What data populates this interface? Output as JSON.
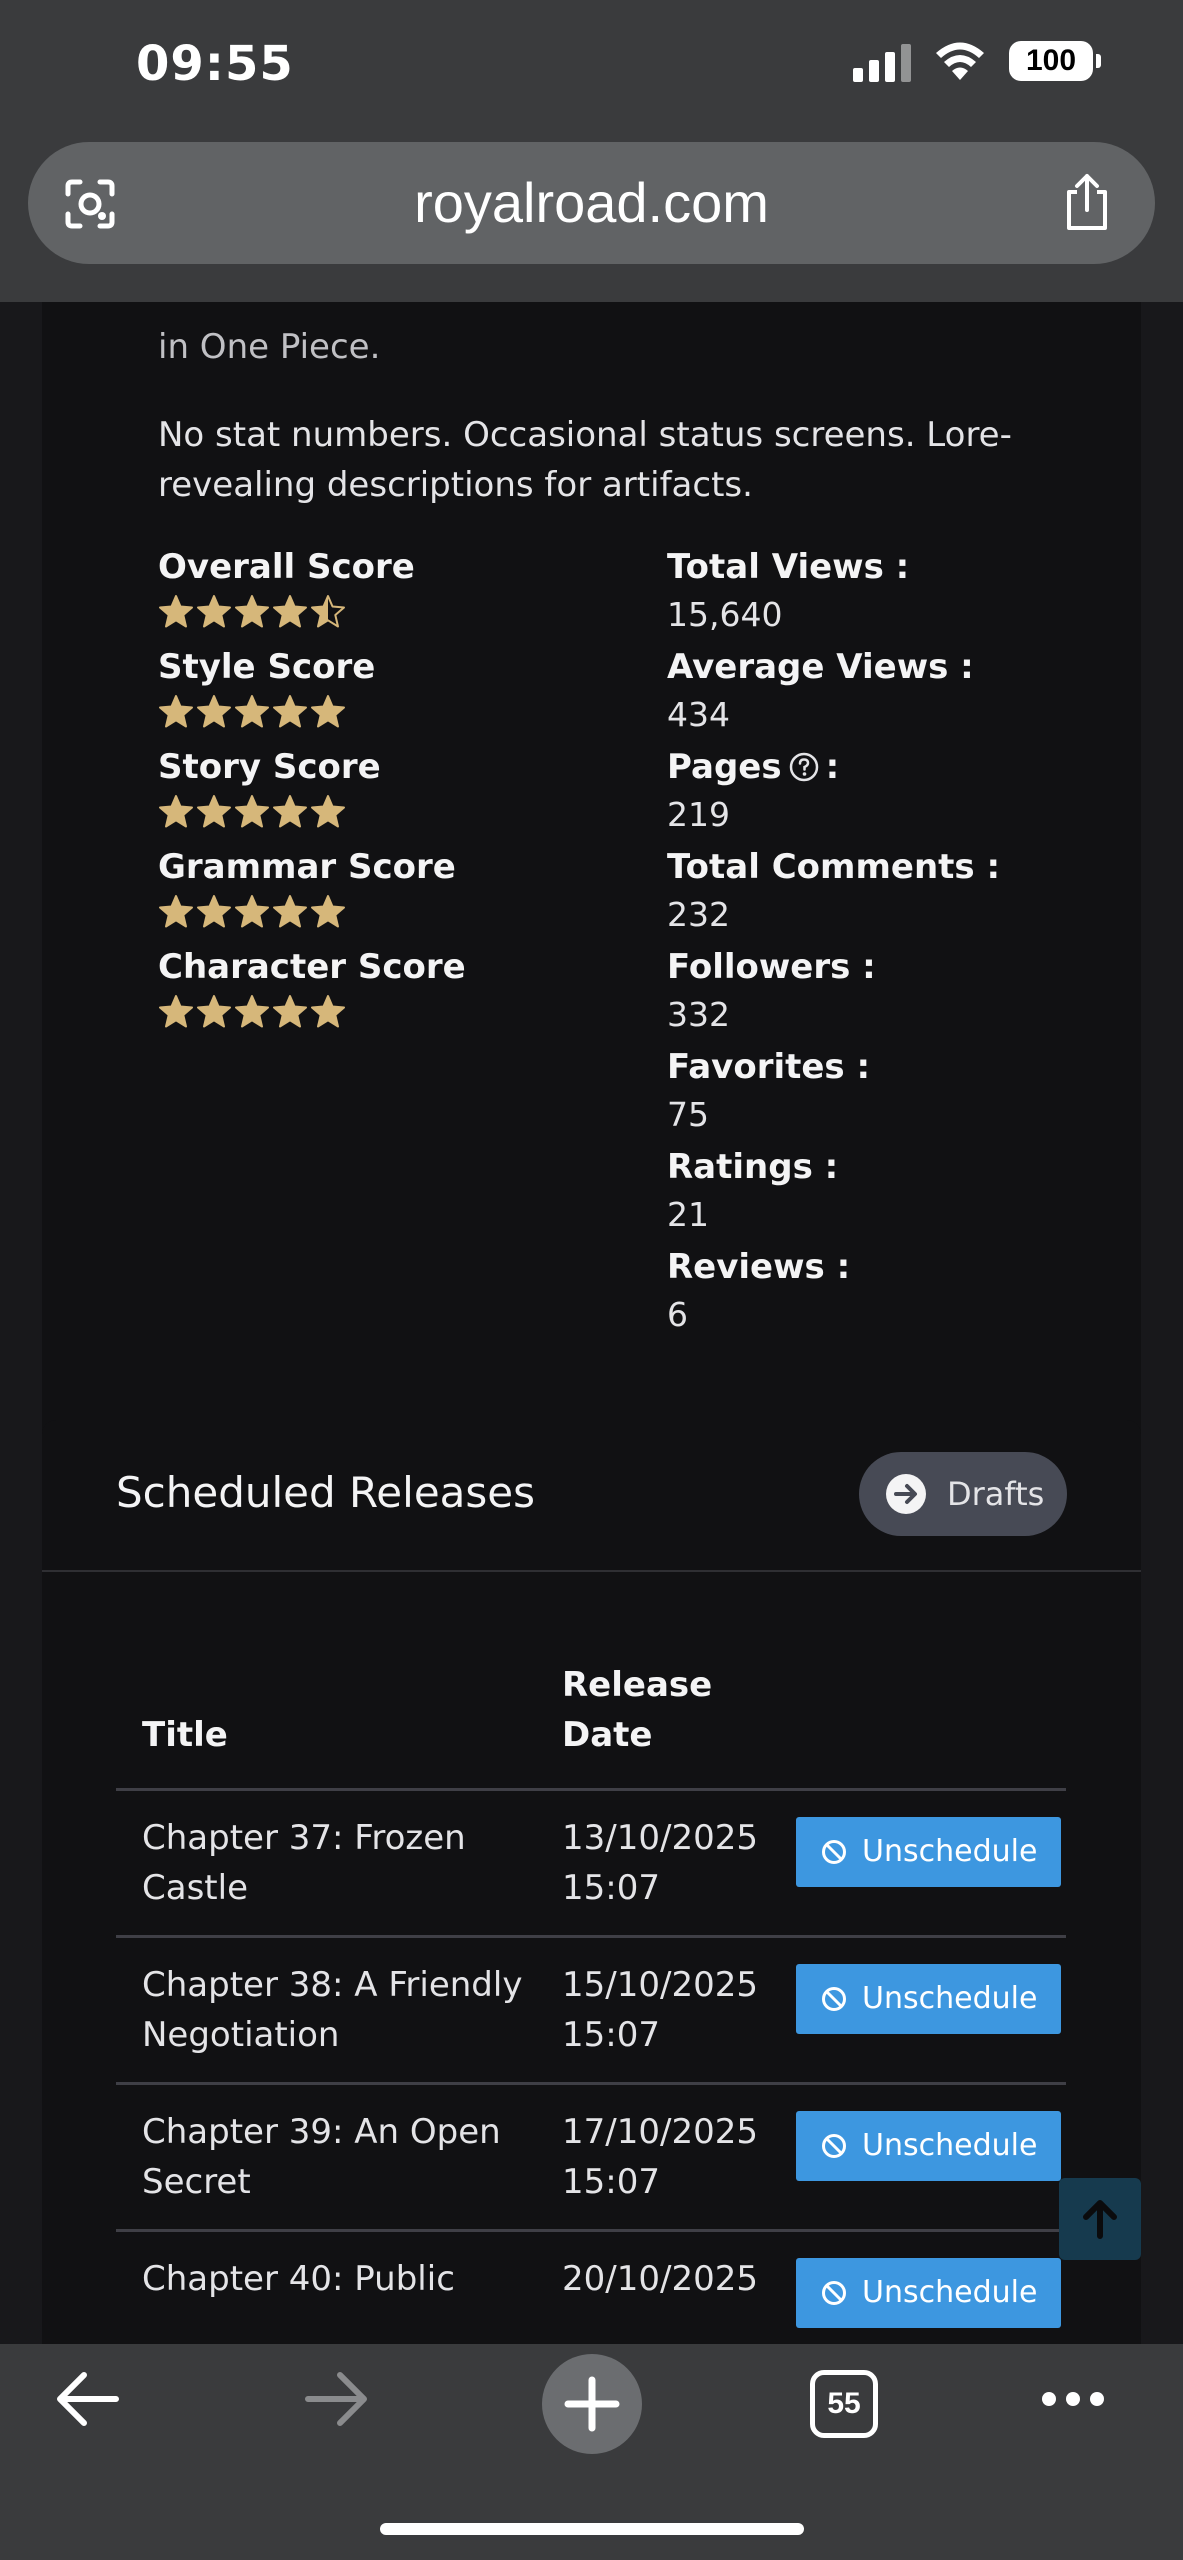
{
  "status_bar": {
    "time": "09:55",
    "battery": "100"
  },
  "browser": {
    "url": "royalroad.com",
    "tab_count": "55"
  },
  "stats_card": {
    "cut_text": "in One Piece.",
    "note": "No stat numbers. Occasional status screens. Lore-revealing descriptions for artifacts.",
    "scores": [
      {
        "label": "Overall Score",
        "rating": 4.5
      },
      {
        "label": "Style Score",
        "rating": 5
      },
      {
        "label": "Story Score",
        "rating": 5
      },
      {
        "label": "Grammar Score",
        "rating": 5
      },
      {
        "label": "Character Score",
        "rating": 5
      }
    ],
    "stats": [
      {
        "label": "Total Views :",
        "value": "15,640"
      },
      {
        "label": "Average Views :",
        "value": "434"
      },
      {
        "label": "Pages",
        "suffix": ":",
        "value": "219",
        "help": true
      },
      {
        "label": "Total Comments :",
        "value": "232"
      },
      {
        "label": "Followers :",
        "value": "332"
      },
      {
        "label": "Favorites :",
        "value": "75"
      },
      {
        "label": "Ratings :",
        "value": "21"
      },
      {
        "label": "Reviews :",
        "value": "6"
      }
    ]
  },
  "scheduled": {
    "title": "Scheduled Releases",
    "drafts_label": "Drafts",
    "columns": {
      "title": "Title",
      "date_line1": "Release",
      "date_line2": "Date"
    },
    "unschedule_label": "Unschedule",
    "rows": [
      {
        "title_line1": "Chapter 37: Frozen",
        "title_line2": "Castle",
        "date": "13/10/2025",
        "time": "15:07"
      },
      {
        "title_line1": "Chapter 38: A Friendly",
        "title_line2": "Negotiation",
        "date": "15/10/2025",
        "time": "15:07"
      },
      {
        "title_line1": "Chapter 39: An Open",
        "title_line2": "Secret",
        "date": "17/10/2025",
        "time": "15:07"
      },
      {
        "title_line1": "Chapter 40: Public",
        "title_line2": "",
        "date": "20/10/2025",
        "time": ""
      }
    ]
  },
  "colors": {
    "star": "#d6b77a",
    "button_blue": "#3d97e0",
    "toolbar": "#3a3b3d"
  },
  "icons": [
    "lens-icon",
    "share-icon",
    "star-icon",
    "help-icon",
    "arrow-right-circle-icon",
    "ban-icon",
    "arrow-up-icon",
    "back-icon",
    "forward-icon",
    "plus-icon",
    "more-icon"
  ]
}
